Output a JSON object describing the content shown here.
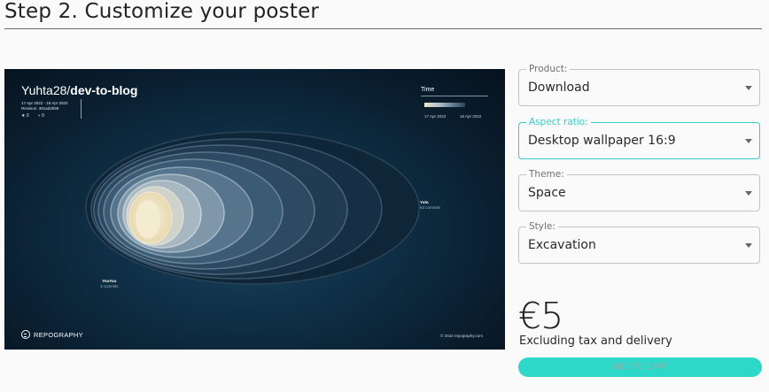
{
  "page": {
    "title": "Step 2. Customize your poster"
  },
  "poster": {
    "repo_owner": "Yuhta28/",
    "repo_name": "dev-to-blog",
    "date_range": "17 Apr 2022 - 18 Apr 2022",
    "revision": "Revision: 391ad2b69",
    "stars": "0",
    "forks": "0",
    "time_label": "Time",
    "time_start": "17 Apr 2022",
    "time_end": "18 Apr 2022",
    "contributors": [
      {
        "name": "Yuta",
        "commits": "63 commits"
      },
      {
        "name": "YouYou",
        "commits": "3 commits"
      }
    ],
    "brand": "REPOGRAPHY",
    "copyright": "© 2022 repography.com",
    "colors": {
      "bg": "#0b2233",
      "accent": "#f2e6c4"
    }
  },
  "options": [
    {
      "label": "Product:",
      "value": "Download"
    },
    {
      "label": "Aspect ratio:",
      "value": "Desktop wallpaper 16:9"
    },
    {
      "label": "Theme:",
      "value": "Space"
    },
    {
      "label": "Style:",
      "value": "Excavation"
    }
  ],
  "price": {
    "amount": "€5",
    "note": "Excluding tax and delivery"
  },
  "cart_button": {
    "label": "ADD TO CART",
    "color": "#2dd8c9"
  },
  "colors": {
    "accent": "#2fd0cb"
  }
}
